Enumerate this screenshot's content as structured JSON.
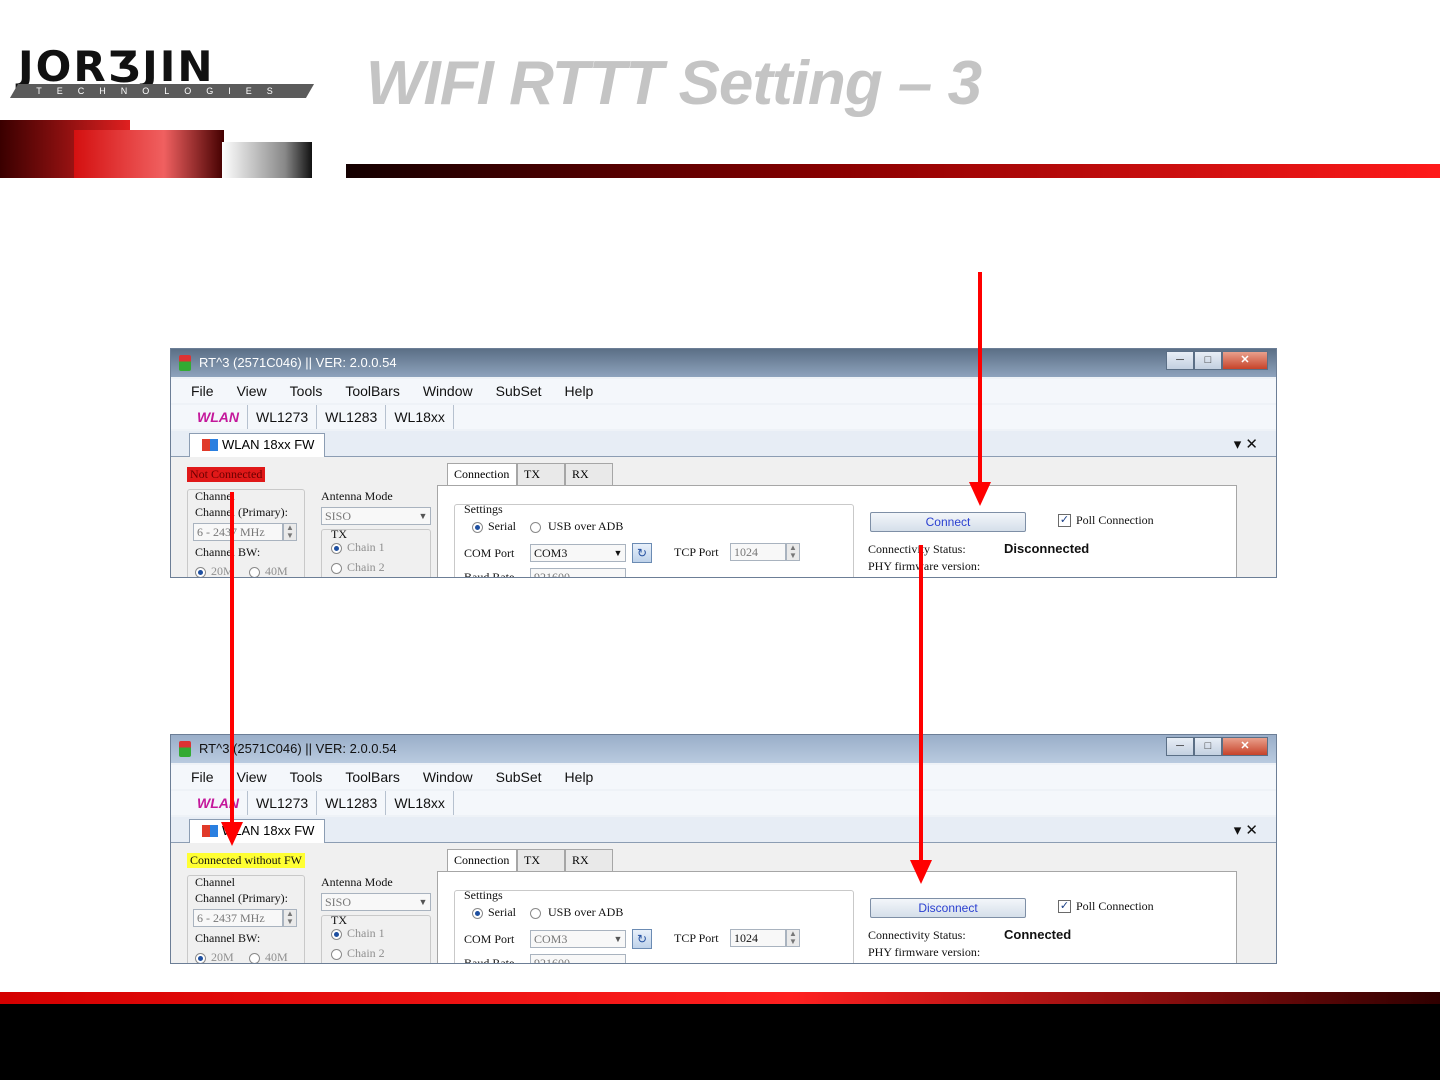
{
  "slide": {
    "title": "WIFI RTTT Setting – 3",
    "logo_text": "JORƷJIN",
    "logo_subtitle": "TECHNOLOGIES"
  },
  "windows": [
    {
      "title": "RT^3 (2571C046) || VER: 2.0.0.54",
      "menu": [
        "File",
        "View",
        "Tools",
        "ToolBars",
        "Window",
        "SubSet",
        "Help"
      ],
      "toolbar": [
        "WLAN",
        "WL1273",
        "WL1283",
        "WL18xx"
      ],
      "doc_tab": "WLAN 18xx FW",
      "dock_controls": "▾ ✕",
      "status_label": "Not Connected",
      "channel": {
        "group_label": "Channel",
        "primary_label": "Channel (Primary):",
        "primary_value": "6  - 2437 MHz",
        "bw_label": "Channel BW:",
        "bw_options": [
          "20M",
          "40M"
        ]
      },
      "antenna": {
        "label": "Antenna Mode",
        "value": "SISO",
        "tx_label": "TX",
        "chains": [
          "Chain 1",
          "Chain 2"
        ]
      },
      "panel_tabs": [
        "Connection",
        "TX",
        "RX"
      ],
      "settings": {
        "label": "Settings",
        "serial": "Serial",
        "usb": "USB over ADB",
        "com_label": "COM Port",
        "com_value": "COM3",
        "tcp_label": "TCP Port",
        "tcp_value": "1024",
        "baud_label": "Baud Rate",
        "baud_value": "921600"
      },
      "connect_button": "Connect",
      "poll_label": "Poll Connection",
      "connectivity_label": "Connectivity Status:",
      "connectivity_value": "Disconnected",
      "phy_label": "PHY firmware version:"
    },
    {
      "title": "RT^3 (2571C046) || VER: 2.0.0.54",
      "menu": [
        "File",
        "View",
        "Tools",
        "ToolBars",
        "Window",
        "SubSet",
        "Help"
      ],
      "toolbar": [
        "WLAN",
        "WL1273",
        "WL1283",
        "WL18xx"
      ],
      "doc_tab": "WLAN 18xx FW",
      "dock_controls": "▾ ✕",
      "status_label": "Connected without FW",
      "channel": {
        "group_label": "Channel",
        "primary_label": "Channel (Primary):",
        "primary_value": "6  - 2437 MHz",
        "bw_label": "Channel BW:",
        "bw_options": [
          "20M",
          "40M"
        ]
      },
      "antenna": {
        "label": "Antenna Mode",
        "value": "SISO",
        "tx_label": "TX",
        "chains": [
          "Chain 1",
          "Chain 2"
        ]
      },
      "panel_tabs": [
        "Connection",
        "TX",
        "RX"
      ],
      "settings": {
        "label": "Settings",
        "serial": "Serial",
        "usb": "USB over ADB",
        "com_label": "COM Port",
        "com_value": "COM3",
        "tcp_label": "TCP Port",
        "tcp_value": "1024",
        "baud_label": "Baud Rate",
        "baud_value": "921600"
      },
      "connect_button": "Disconnect",
      "poll_label": "Poll Connection",
      "connectivity_label": "Connectivity Status:",
      "connectivity_value": "Connected",
      "phy_label": "PHY firmware version:"
    }
  ],
  "colors": {
    "arrow": "#ff0000",
    "status_not_connected": "#e01818",
    "status_connected_no_fw": "#ffff33",
    "wlan_toolbar": "#c4189b"
  }
}
